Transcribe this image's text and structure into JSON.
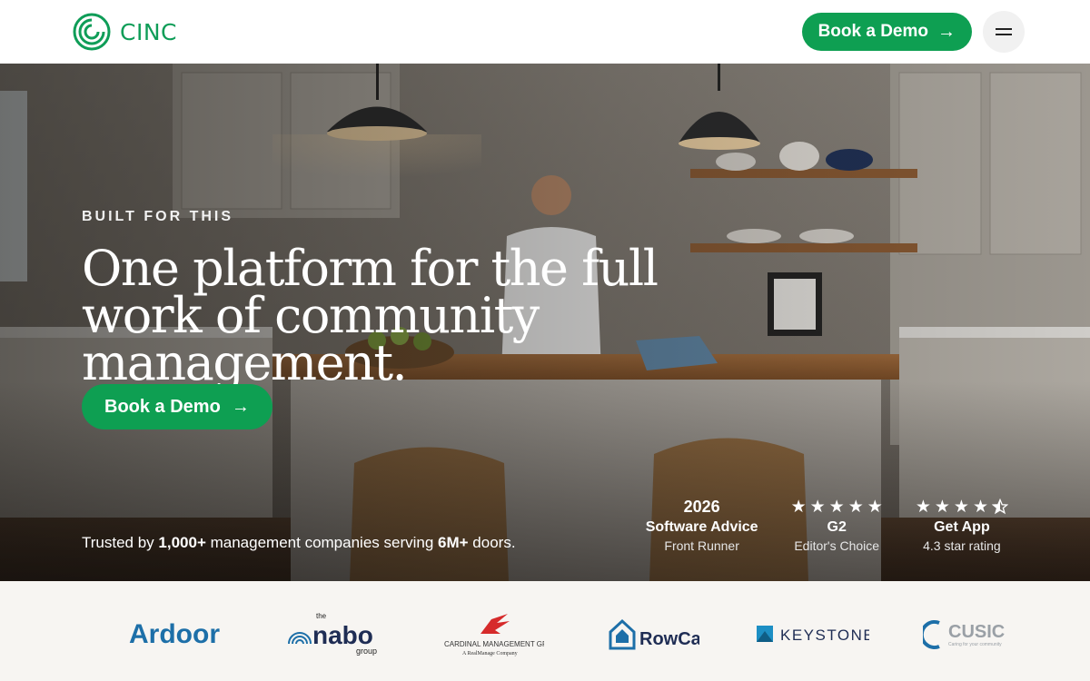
{
  "nav": {
    "brand_name": "CINC",
    "demo_button": "Book a Demo"
  },
  "hero": {
    "eyebrow": "BUILT FOR THIS",
    "headline": "One platform for the full work of community management.",
    "cta": "Book a Demo",
    "trusted_prefix": "Trusted by ",
    "trusted_count": "1,000+",
    "trusted_middle": " management companies serving ",
    "trusted_doors": "6M+",
    "trusted_suffix": " doors."
  },
  "awards": [
    {
      "top": "2026",
      "title": "Software Advice",
      "sub": "Front Runner"
    },
    {
      "stars": 5,
      "title": "G2",
      "sub": "Editor's Choice"
    },
    {
      "stars": 4.5,
      "title": "Get App",
      "sub": "4.3 star rating"
    }
  ],
  "logos": [
    {
      "name": "Ardoor"
    },
    {
      "name": "the nabo group"
    },
    {
      "name": "CARDINAL MANAGEMENT GROUP",
      "tagline": "A RealManage Company"
    },
    {
      "name": "RowCal"
    },
    {
      "name": "KEYSTONE"
    },
    {
      "name": "CUSIC",
      "tagline": "Caring for your community"
    }
  ],
  "colors": {
    "brand_green": "#0e9f52",
    "logo_blue": "#1d6fa8"
  }
}
